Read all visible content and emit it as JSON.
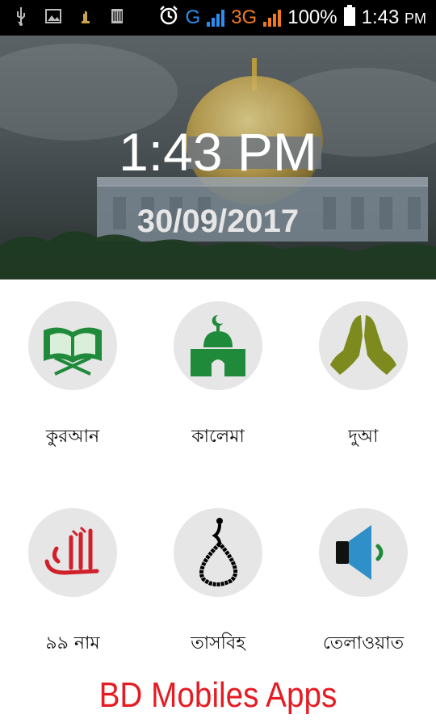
{
  "status_bar": {
    "icons": [
      "usb-icon",
      "image-icon",
      "notification-icon",
      "sim-icon",
      "alarm-icon",
      "signal-icon",
      "battery-icon"
    ],
    "network_g": "G",
    "network_3g": "3G",
    "battery": "100%",
    "time": "1:43",
    "ampm": "PM"
  },
  "header": {
    "time": "1:43 PM",
    "date": "30/09/2017"
  },
  "menu": {
    "items": [
      {
        "label": "কুরআন",
        "icon": "quran-icon"
      },
      {
        "label": "কালেমা",
        "icon": "mosque-icon"
      },
      {
        "label": "দুআ",
        "icon": "praying-hands-icon"
      },
      {
        "label": "৯৯ নাম",
        "icon": "allah-calligraphy-icon"
      },
      {
        "label": "তাসবিহ",
        "icon": "tasbih-icon"
      },
      {
        "label": "তেলাওয়াত",
        "icon": "speaker-icon"
      }
    ]
  },
  "footer": {
    "brand": "BD Mobiles Apps"
  },
  "colors": {
    "brand_red": "#e41c23",
    "icon_green": "#1f8a3a",
    "hands_olive": "#7d8a1e",
    "allah_red": "#d0202a",
    "speaker_blue": "#2f8fc9"
  }
}
